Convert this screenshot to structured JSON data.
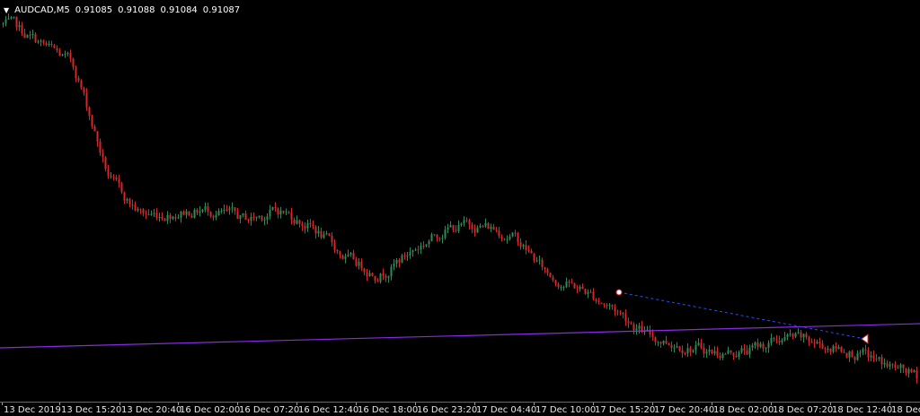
{
  "window": {
    "symbol_timeframe": "AUDCAD,M5",
    "ohlc": [
      "0.91085",
      "0.91088",
      "0.91084",
      "0.91087"
    ],
    "dropdown_icon": "triangle-down-icon"
  },
  "colors": {
    "background": "#000000",
    "bull_candle": "#2e8b57",
    "bear_candle": "#d2282a",
    "trend_line": "#8a2be2",
    "dashed_line": "#1e50ff",
    "axis_text": "#e6e6e6"
  },
  "time_axis": {
    "labels": [
      "13 Dec 2019",
      "13 Dec 15:20",
      "13 Dec 20:40",
      "16 Dec 02:00",
      "16 Dec 07:20",
      "16 Dec 12:40",
      "16 Dec 18:00",
      "16 Dec 23:20",
      "17 Dec 04:40",
      "17 Dec 10:00",
      "17 Dec 15:20",
      "17 Dec 20:40",
      "18 Dec 02:00",
      "18 Dec 07:20",
      "18 Dec 12:40",
      "18 Dec"
    ]
  },
  "chart_data": {
    "type": "candlestick",
    "series": [
      {
        "name": "AUDCAD,M5",
        "values": [
          [
            0.912,
            0.9147
          ],
          [
            0.91,
            0.914
          ],
          [
            0.908,
            0.9131
          ],
          [
            0.898,
            0.9074
          ],
          [
            0.897,
            0.9039
          ],
          [
            0.898,
            0.9036
          ],
          [
            0.898,
            0.9039
          ],
          [
            0.897,
            0.9032
          ],
          [
            0.898,
            0.9039
          ],
          [
            0.897,
            0.9025
          ],
          [
            0.895,
            0.9001
          ],
          [
            0.894,
            0.8991
          ],
          [
            0.896,
            0.9005
          ],
          [
            0.897,
            0.9025
          ],
          [
            0.897,
            0.9028
          ],
          [
            0.896,
            0.9022
          ],
          [
            0.894,
            0.8988
          ],
          [
            0.893,
            0.898
          ],
          [
            0.892,
            0.8963
          ],
          [
            0.8915,
            0.893
          ],
          [
            0.891,
            0.8927
          ],
          [
            0.891,
            0.8915
          ],
          [
            0.891,
            0.892
          ],
          [
            0.892,
            0.8927
          ],
          [
            0.891,
            0.8927
          ],
          [
            0.891,
            0.8917
          ],
          [
            0.89,
            0.8908
          ],
          [
            0.889,
            0.89
          ]
        ]
      }
    ],
    "ylim": [
      0.888,
      0.915
    ],
    "grid": false
  }
}
